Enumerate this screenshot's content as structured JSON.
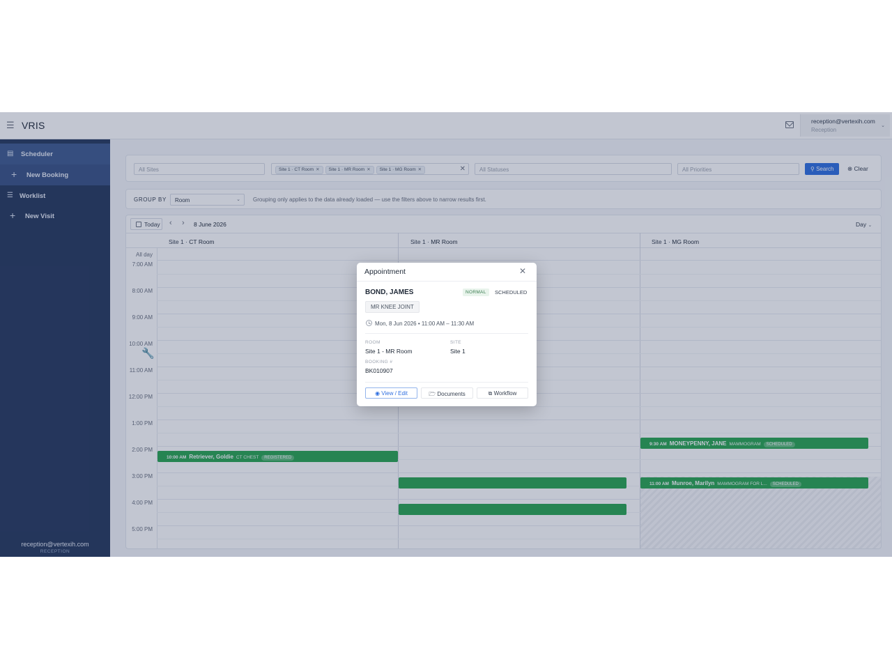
{
  "app": {
    "title": "VRIS",
    "menu_icon": "hamburger-icon"
  },
  "header": {
    "user_email": "reception@vertexih.com",
    "user_role": "Reception",
    "mail_icon": "mail-icon"
  },
  "sidebar": {
    "items": [
      {
        "label": "Scheduler",
        "icon": "calendar-icon"
      },
      {
        "label": "New Booking",
        "icon": "plus-icon"
      },
      {
        "label": "Worklist",
        "icon": "list-icon"
      },
      {
        "label": "New Visit",
        "icon": "plus-icon"
      }
    ],
    "footer_email": "reception@vertexih.com",
    "footer_role": "RECEPTION"
  },
  "filters": {
    "sites_placeholder": "All Sites",
    "rooms_chips": [
      "Site 1 · CT Room",
      "Site 1 · MR Room",
      "Site 1 · MG Room"
    ],
    "statuses_placeholder": "All Statuses",
    "priorities_placeholder": "All Priorities",
    "search_label": "Search",
    "clear_label": "Clear"
  },
  "group_by": {
    "label": "GROUP BY",
    "value": "Room",
    "note": "Grouping only applies to the data already loaded — use the filters above to narrow results first."
  },
  "calendar": {
    "today_label": "Today",
    "date": "8 June 2026",
    "view": "Day",
    "columns": [
      {
        "site": "Site 1 · ",
        "room": "CT Room"
      },
      {
        "site": "Site 1 · ",
        "room": "MR Room"
      },
      {
        "site": "Site 1 · ",
        "room": "MG Room"
      }
    ],
    "all_day_label": "All day",
    "times": [
      "7:00 AM",
      "8:00 AM",
      "9:00 AM",
      "10:00 AM",
      "11:00 AM",
      "12:00 PM",
      "1:00 PM",
      "2:00 PM",
      "3:00 PM",
      "4:00 PM",
      "5:00 PM"
    ],
    "events": [
      {
        "time": "10:00 AM",
        "name": "Retriever, Goldie",
        "procedure": "CT CHEST",
        "status": "REGISTERED"
      },
      {
        "time": "9:30 AM",
        "name": "MONEYPENNY, JANE",
        "procedure": "MAMMOGRAM",
        "status": "SCHEDULED"
      },
      {
        "time": "11:00 AM",
        "name": "Munroe, Marilyn",
        "procedure": "MAMMOGRAM FOR L...",
        "status": "SCHEDULED"
      }
    ],
    "color_event": "#2aa552"
  },
  "dialog": {
    "title": "Appointment",
    "patient": "BOND, JAMES",
    "priority": "NORMAL",
    "status": "SCHEDULED",
    "procedure": "MR KNEE JOINT",
    "when": "Mon, 8 Jun 2026  •  11:00 AM – 11:30 AM",
    "room_label": "ROOM",
    "room_value": "Site 1 - MR Room",
    "site_label": "SITE",
    "site_value": "Site 1",
    "booking_label": "BOOKING #",
    "booking_value": "BK010907",
    "buttons": {
      "view_edit": "View / Edit",
      "documents": "Documents",
      "workflow": "Workflow"
    }
  }
}
